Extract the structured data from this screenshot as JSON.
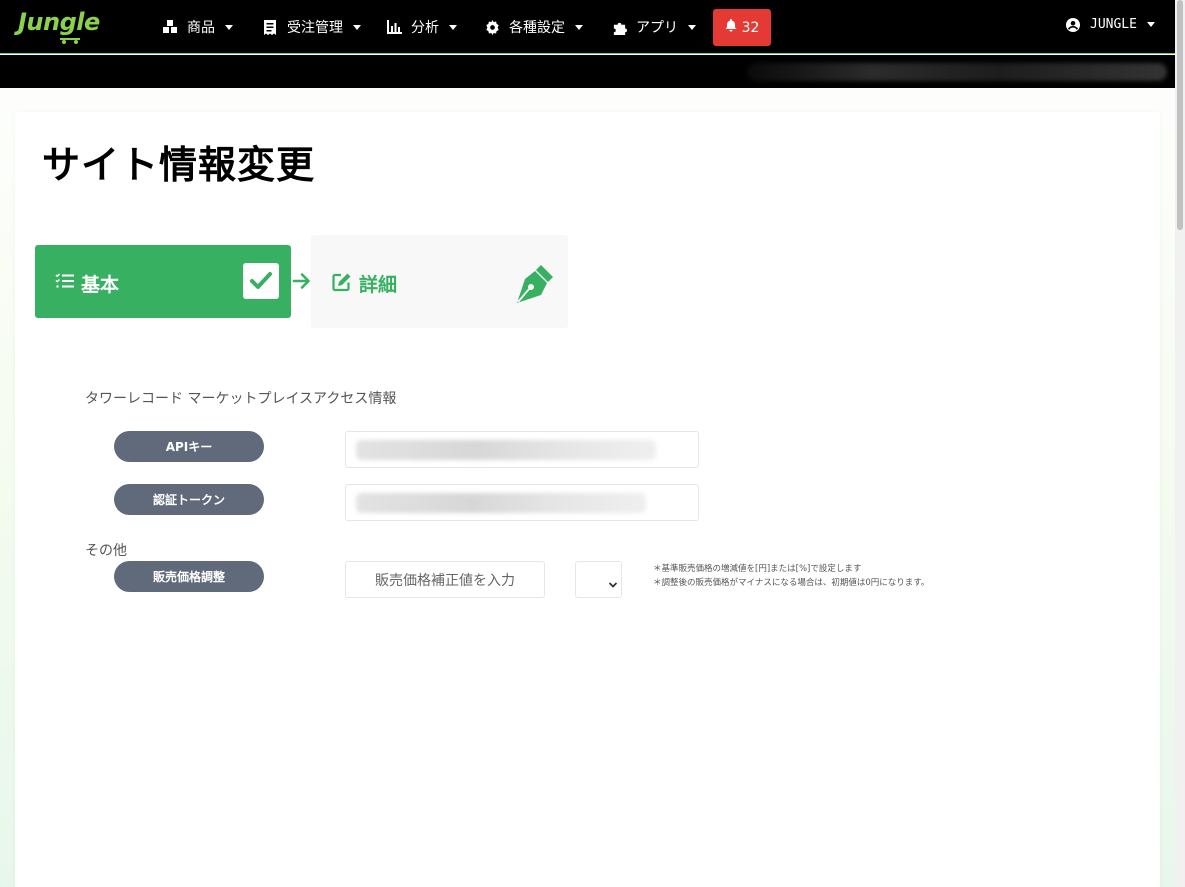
{
  "brand": {
    "logo_text": "Jungle"
  },
  "nav": {
    "items": [
      {
        "label": "商品",
        "icon": "boxes-icon"
      },
      {
        "label": "受注管理",
        "icon": "receipt-icon"
      },
      {
        "label": "分析",
        "icon": "bar-chart-icon"
      },
      {
        "label": "各種設定",
        "icon": "gear-icon"
      },
      {
        "label": "アプリ",
        "icon": "puzzle-icon"
      }
    ],
    "notifications": {
      "count": "32",
      "icon": "bell-icon",
      "color": "#e53935"
    },
    "user": {
      "name": "JUNGLE",
      "icon": "user-circle-icon"
    }
  },
  "page": {
    "title": "サイト情報変更"
  },
  "steps": {
    "basic": {
      "label": "基本",
      "status": "completed",
      "color": "#38b062"
    },
    "detail": {
      "label": "詳細",
      "status": "current"
    }
  },
  "form": {
    "section_title": "タワーレコード マーケットプレイスアクセス情報",
    "api_key": {
      "label": "APIキー"
    },
    "auth_token": {
      "label": "認証トークン"
    },
    "other_section": "その他",
    "price_adjust": {
      "label": "販売価格調整",
      "placeholder": "販売価格補正値を入力",
      "unit_value": ""
    },
    "notes": [
      "＊基準販売価格の増減値を[円]または[%]で設定します",
      "＊調整後の販売価格がマイナスになる場合は、初期値は0円になります。"
    ]
  }
}
